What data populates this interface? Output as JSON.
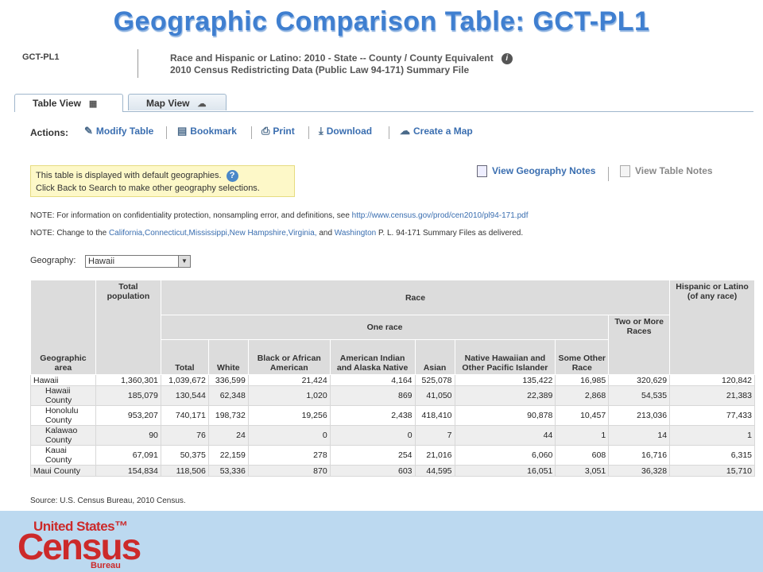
{
  "slide_title": "Geographic Comparison Table:  GCT-PL1",
  "header": {
    "code": "GCT-PL1",
    "line1": "Race and Hispanic or Latino: 2010 - State -- County / County Equivalent",
    "line2": "2010 Census Redistricting Data (Public Law 94-171) Summary File",
    "info_icon": "info-icon"
  },
  "tabs": [
    {
      "label": "Table View",
      "icon": "table-grid-icon"
    },
    {
      "label": "Map View",
      "icon": "us-map-icon"
    }
  ],
  "actions": {
    "label": "Actions:",
    "items": [
      {
        "label": "Modify Table",
        "icon": "modify-table-icon"
      },
      {
        "label": "Bookmark",
        "icon": "bookmark-icon"
      },
      {
        "label": "Print",
        "icon": "print-icon"
      },
      {
        "label": "Download",
        "icon": "download-icon"
      },
      {
        "label": "Create a Map",
        "icon": "map-icon"
      }
    ]
  },
  "notice": {
    "line1": "This table is displayed with default geographies.",
    "line2": "Click Back to Search to make other geography selections."
  },
  "notes_links": {
    "geo_notes": "View Geography Notes",
    "table_notes": "View Table Notes"
  },
  "note1": {
    "prefix": "NOTE: For information on confidentiality protection, nonsampling error, and definitions, see ",
    "link": "http://www.census.gov/prod/cen2010/pl94-171.pdf"
  },
  "note2": {
    "prefix": "NOTE: Change to the ",
    "states": "California,Connecticut,Mississippi,New Hampshire,Virginia,",
    "and": " and ",
    "washington": "Washington",
    "suffix": " P. L. 94-171 Summary Files as delivered."
  },
  "geography": {
    "label": "Geography:",
    "selected": "Hawaii"
  },
  "table": {
    "headers": {
      "geographic_area": "Geographic area",
      "total_population": "Total population",
      "race": "Race",
      "one_race": "One race",
      "two_or_more": "Two or More Races",
      "hispanic": "Hispanic or Latino (of any race)",
      "total": "Total",
      "white": "White",
      "black": "Black or African American",
      "american_indian": "American Indian and Alaska Native",
      "asian": "Asian",
      "native_hawaiian": "Native Hawaiian and Other Pacific Islander",
      "some_other": "Some Other Race"
    },
    "rows": [
      {
        "area": "Hawaii",
        "total_pop": "1,360,301",
        "total": "1,039,672",
        "white": "336,599",
        "black": "21,424",
        "aian": "4,164",
        "asian": "525,078",
        "nhpi": "135,422",
        "other": "16,985",
        "two": "320,629",
        "hisp": "120,842"
      },
      {
        "area": "Hawaii County",
        "total_pop": "185,079",
        "total": "130,544",
        "white": "62,348",
        "black": "1,020",
        "aian": "869",
        "asian": "41,050",
        "nhpi": "22,389",
        "other": "2,868",
        "two": "54,535",
        "hisp": "21,383"
      },
      {
        "area": "Honolulu County",
        "total_pop": "953,207",
        "total": "740,171",
        "white": "198,732",
        "black": "19,256",
        "aian": "2,438",
        "asian": "418,410",
        "nhpi": "90,878",
        "other": "10,457",
        "two": "213,036",
        "hisp": "77,433"
      },
      {
        "area": "Kalawao County",
        "total_pop": "90",
        "total": "76",
        "white": "24",
        "black": "0",
        "aian": "0",
        "asian": "7",
        "nhpi": "44",
        "other": "1",
        "two": "14",
        "hisp": "1"
      },
      {
        "area": "Kauai County",
        "total_pop": "67,091",
        "total": "50,375",
        "white": "22,159",
        "black": "278",
        "aian": "254",
        "asian": "21,016",
        "nhpi": "6,060",
        "other": "608",
        "two": "16,716",
        "hisp": "6,315"
      },
      {
        "area": "Maui County",
        "total_pop": "154,834",
        "total": "118,506",
        "white": "53,336",
        "black": "870",
        "aian": "603",
        "asian": "44,595",
        "nhpi": "16,051",
        "other": "3,051",
        "two": "36,328",
        "hisp": "15,710"
      }
    ]
  },
  "source": "Source: U.S. Census Bureau, 2010 Census.",
  "logo": {
    "line1": "United States™",
    "line2": "Census",
    "line3": "Bureau"
  }
}
